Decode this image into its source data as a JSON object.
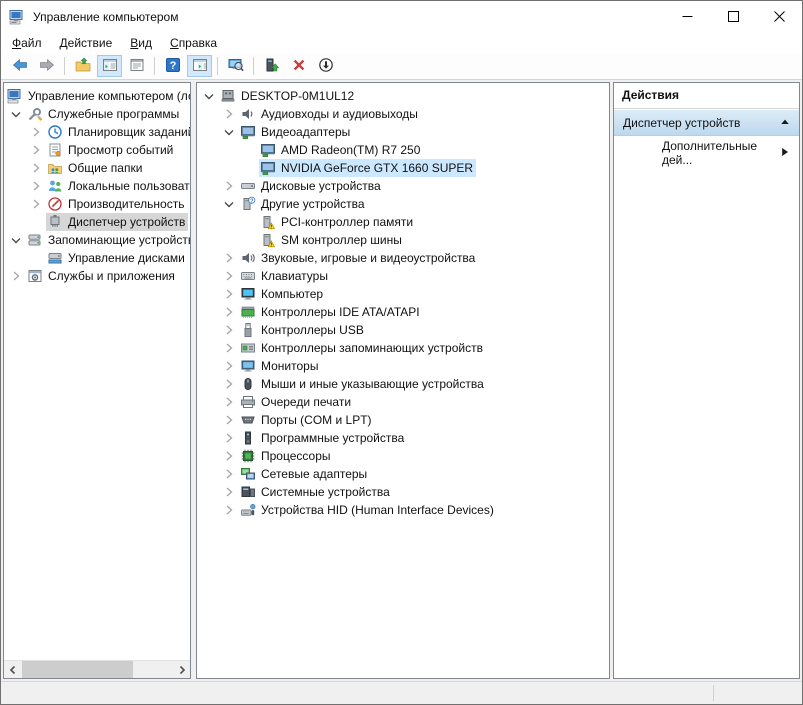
{
  "window": {
    "title": "Управление компьютером"
  },
  "menu": {
    "items": [
      {
        "name": "file",
        "label": "Файл"
      },
      {
        "name": "action",
        "label": "Действие"
      },
      {
        "name": "view",
        "label": "Вид"
      },
      {
        "name": "help",
        "label": "Справка"
      }
    ]
  },
  "toolbar": {
    "buttons": [
      {
        "name": "back",
        "icon": "back-arrow-icon",
        "active": false
      },
      {
        "name": "forward",
        "icon": "forward-arrow-icon",
        "active": false
      },
      {
        "sep": true
      },
      {
        "name": "export-list",
        "icon": "export-list-icon",
        "active": false
      },
      {
        "name": "show-console-tree",
        "icon": "console-tree-icon",
        "active": true
      },
      {
        "name": "properties",
        "icon": "properties-icon",
        "active": false
      },
      {
        "sep": true
      },
      {
        "name": "help",
        "icon": "help-icon",
        "active": false
      },
      {
        "name": "show-action-pane",
        "icon": "action-pane-icon",
        "active": true
      },
      {
        "sep": true
      },
      {
        "name": "scan-hardware-changes",
        "icon": "scan-hardware-icon",
        "active": false
      },
      {
        "sep": true
      },
      {
        "name": "update-driver",
        "icon": "update-driver-icon",
        "active": false
      },
      {
        "name": "uninstall-device",
        "icon": "uninstall-icon",
        "active": false
      },
      {
        "name": "disable-device",
        "icon": "disable-icon",
        "active": false
      }
    ]
  },
  "console_tree": {
    "items": [
      {
        "name": "computer-management-root",
        "label": "Управление компьютером (локальным)",
        "icon": "computer-management-icon",
        "indent": 0,
        "chevron": "noslot",
        "selected": null
      },
      {
        "name": "system-tools",
        "label": "Служебные программы",
        "icon": "tools-icon",
        "indent": 0,
        "chevron": "expanded",
        "selected": null
      },
      {
        "name": "task-scheduler",
        "label": "Планировщик заданий",
        "icon": "task-scheduler-icon",
        "indent": 1,
        "chevron": "collapsed",
        "selected": null
      },
      {
        "name": "event-viewer",
        "label": "Просмотр событий",
        "icon": "event-viewer-icon",
        "indent": 1,
        "chevron": "collapsed",
        "selected": null
      },
      {
        "name": "shared-folders",
        "label": "Общие папки",
        "icon": "shared-folders-icon",
        "indent": 1,
        "chevron": "collapsed",
        "selected": null
      },
      {
        "name": "local-users-groups",
        "label": "Локальные пользователи и группы",
        "icon": "local-users-icon",
        "indent": 1,
        "chevron": "collapsed",
        "selected": null
      },
      {
        "name": "performance",
        "label": "Производительность",
        "icon": "performance-icon",
        "indent": 1,
        "chevron": "collapsed",
        "selected": null
      },
      {
        "name": "device-manager",
        "label": "Диспетчер устройств",
        "icon": "device-manager-icon",
        "indent": 1,
        "chevron": "empty",
        "selected": "gray"
      },
      {
        "name": "storage",
        "label": "Запоминающие устройства",
        "icon": "storage-devices-icon",
        "indent": 0,
        "chevron": "expanded",
        "selected": null
      },
      {
        "name": "disk-management",
        "label": "Управление дисками",
        "icon": "disk-management-icon",
        "indent": 1,
        "chevron": "empty",
        "selected": null
      },
      {
        "name": "services-applications",
        "label": "Службы и приложения",
        "icon": "services-icon",
        "indent": 0,
        "chevron": "collapsed",
        "selected": null
      }
    ]
  },
  "device_tree": {
    "items": [
      {
        "name": "desktop-root",
        "label": "DESKTOP-0M1UL12",
        "icon": "computer-icon",
        "indent": 0,
        "chevron": "expanded",
        "selected": null
      },
      {
        "name": "audio-inputs-outputs",
        "label": "Аудиовходы и аудиовыходы",
        "icon": "audio-device-icon",
        "indent": 1,
        "chevron": "collapsed",
        "selected": null
      },
      {
        "name": "display-adapters",
        "label": "Видеоадаптеры",
        "icon": "display-adapter-icon",
        "indent": 1,
        "chevron": "expanded",
        "selected": null
      },
      {
        "name": "amd-radeon-r7-250",
        "label": "AMD Radeon(TM) R7 250",
        "icon": "display-adapter-icon",
        "indent": 2,
        "chevron": "empty",
        "selected": null
      },
      {
        "name": "nvidia-gtx-1660-super",
        "label": "NVIDIA GeForce GTX 1660 SUPER",
        "icon": "display-adapter-icon",
        "indent": 2,
        "chevron": "empty",
        "selected": "blue"
      },
      {
        "name": "disk-drives",
        "label": "Дисковые устройства",
        "icon": "disk-drive-icon",
        "indent": 1,
        "chevron": "collapsed",
        "selected": null
      },
      {
        "name": "other-devices",
        "label": "Другие устройства",
        "icon": "unknown-device-icon",
        "indent": 1,
        "chevron": "expanded",
        "selected": null
      },
      {
        "name": "pci-memory-controller",
        "label": "PCI-контроллер памяти",
        "icon": "warning-device-icon",
        "indent": 2,
        "chevron": "empty",
        "selected": null
      },
      {
        "name": "sm-bus-controller",
        "label": "SM контроллер шины",
        "icon": "warning-device-icon",
        "indent": 2,
        "chevron": "empty",
        "selected": null
      },
      {
        "name": "sound-video-game",
        "label": "Звуковые, игровые и видеоустройства",
        "icon": "sound-device-icon",
        "indent": 1,
        "chevron": "collapsed",
        "selected": null
      },
      {
        "name": "keyboards",
        "label": "Клавиатуры",
        "icon": "keyboard-icon",
        "indent": 1,
        "chevron": "collapsed",
        "selected": null
      },
      {
        "name": "computer",
        "label": "Компьютер",
        "icon": "computer-monitor-icon",
        "indent": 1,
        "chevron": "collapsed",
        "selected": null
      },
      {
        "name": "ide-controllers",
        "label": "Контроллеры IDE ATA/ATAPI",
        "icon": "ide-controller-icon",
        "indent": 1,
        "chevron": "collapsed",
        "selected": null
      },
      {
        "name": "usb-controllers",
        "label": "Контроллеры USB",
        "icon": "usb-controller-icon",
        "indent": 1,
        "chevron": "collapsed",
        "selected": null
      },
      {
        "name": "storage-controllers",
        "label": "Контроллеры запоминающих устройств",
        "icon": "storage-controller-icon",
        "indent": 1,
        "chevron": "collapsed",
        "selected": null
      },
      {
        "name": "monitors",
        "label": "Мониторы",
        "icon": "monitor-icon",
        "indent": 1,
        "chevron": "collapsed",
        "selected": null
      },
      {
        "name": "mice-pointing",
        "label": "Мыши и иные указывающие устройства",
        "icon": "mouse-icon",
        "indent": 1,
        "chevron": "collapsed",
        "selected": null
      },
      {
        "name": "print-queues",
        "label": "Очереди печати",
        "icon": "printer-icon",
        "indent": 1,
        "chevron": "collapsed",
        "selected": null
      },
      {
        "name": "ports-com-lpt",
        "label": "Порты (COM и LPT)",
        "icon": "ports-icon",
        "indent": 1,
        "chevron": "collapsed",
        "selected": null
      },
      {
        "name": "software-devices",
        "label": "Программные устройства",
        "icon": "software-device-icon",
        "indent": 1,
        "chevron": "collapsed",
        "selected": null
      },
      {
        "name": "processors",
        "label": "Процессоры",
        "icon": "processor-icon",
        "indent": 1,
        "chevron": "collapsed",
        "selected": null
      },
      {
        "name": "network-adapters",
        "label": "Сетевые адаптеры",
        "icon": "network-adapter-icon",
        "indent": 1,
        "chevron": "collapsed",
        "selected": null
      },
      {
        "name": "system-devices",
        "label": "Системные устройства",
        "icon": "system-device-icon",
        "indent": 1,
        "chevron": "collapsed",
        "selected": null
      },
      {
        "name": "hid-devices",
        "label": "Устройства HID (Human Interface Devices)",
        "icon": "hid-device-icon",
        "indent": 1,
        "chevron": "collapsed",
        "selected": null
      }
    ]
  },
  "actions_panel": {
    "header": "Действия",
    "group": {
      "title": "Диспетчер устройств"
    },
    "more": {
      "label": "Дополнительные дей..."
    }
  },
  "colors": {
    "selection_active": "#cce8ff",
    "selection_inactive": "#d6d6d6",
    "actions_group_top": "#dcecf8",
    "actions_group_bottom": "#bdd8ee",
    "toolbar_active_bg": "#d3e9fb",
    "warning_yellow": "#fdd835",
    "uninstall_red": "#d73a3a",
    "back_arrow_blue": "#4795d1"
  }
}
